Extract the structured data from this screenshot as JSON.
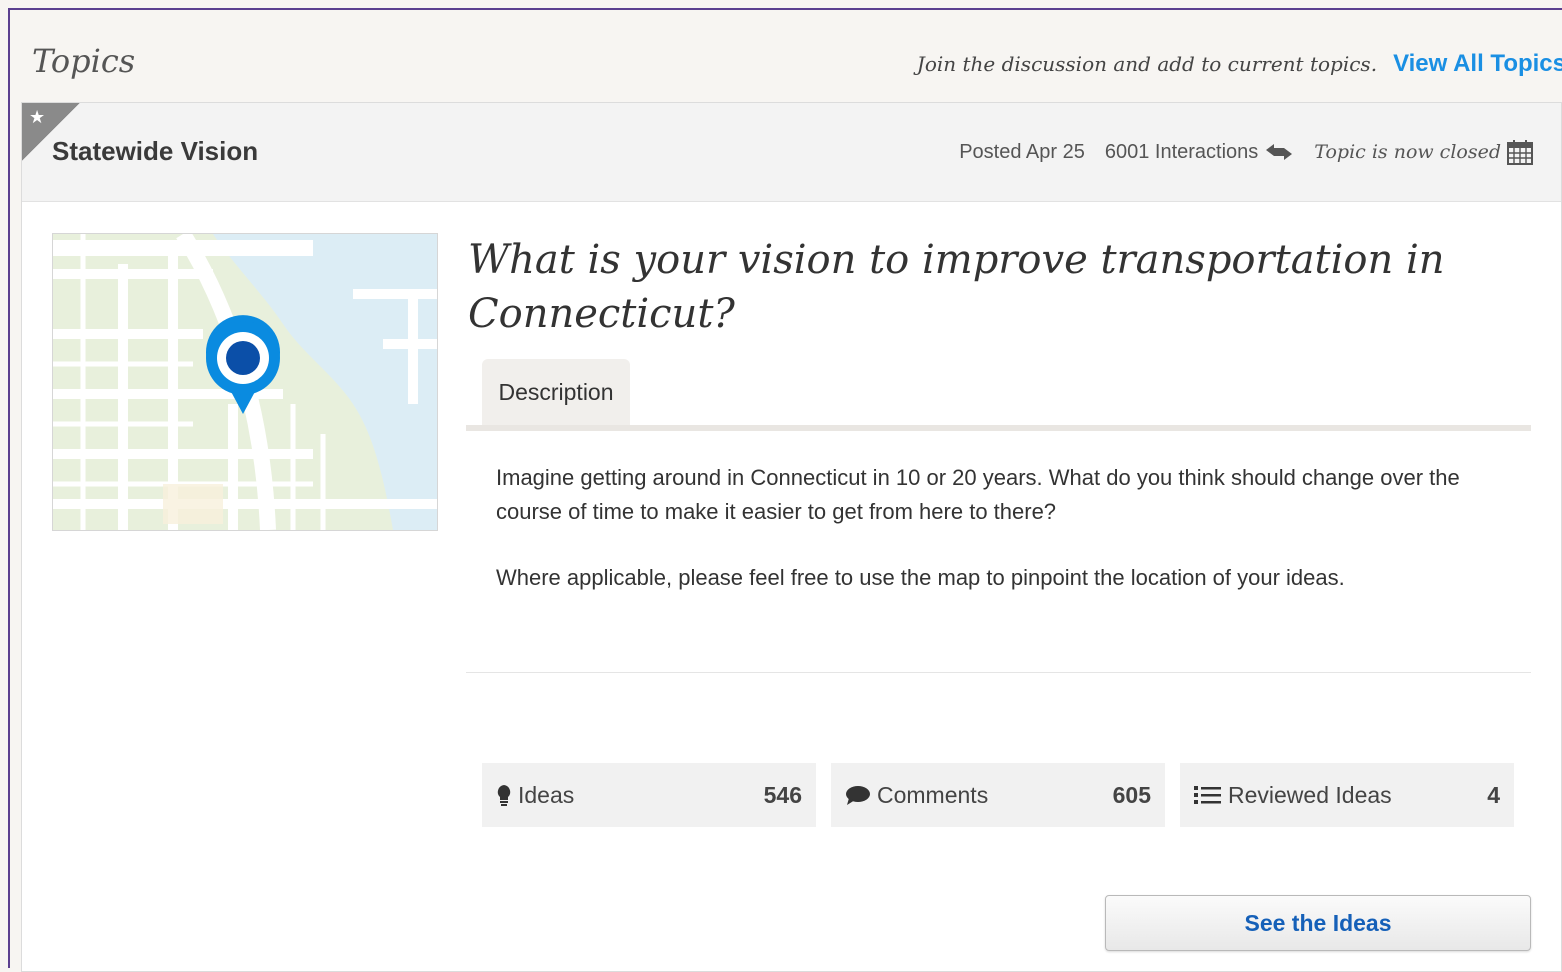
{
  "header": {
    "title": "Topics",
    "tagline": "Join the discussion and add to current topics.",
    "view_all_label": "View All Topics"
  },
  "topic": {
    "title": "Statewide Vision",
    "posted": "Posted Apr 25",
    "interactions": "6001 Interactions",
    "status": "Topic is now closed",
    "question": "What is your vision to improve transportation in Connecticut?",
    "tabs": [
      {
        "label": "Description"
      }
    ],
    "description": [
      "Imagine getting around in Connecticut in 10 or 20 years. What do you think should change over the course of time to make it easier to get from here to there?",
      "Where applicable, please feel free to use the map to pinpoint the location of your ideas."
    ],
    "stats": [
      {
        "label": "Ideas",
        "count": "546",
        "icon": "lightbulb-icon"
      },
      {
        "label": "Comments",
        "count": "605",
        "icon": "comment-icon"
      },
      {
        "label": "Reviewed Ideas",
        "count": "4",
        "icon": "list-icon"
      }
    ],
    "cta_label": "See the Ideas"
  },
  "colors": {
    "link": "#1a8fe3",
    "pin": "#0a8be0",
    "map_land": "#e8f0dc",
    "map_water": "#dcedf5"
  }
}
